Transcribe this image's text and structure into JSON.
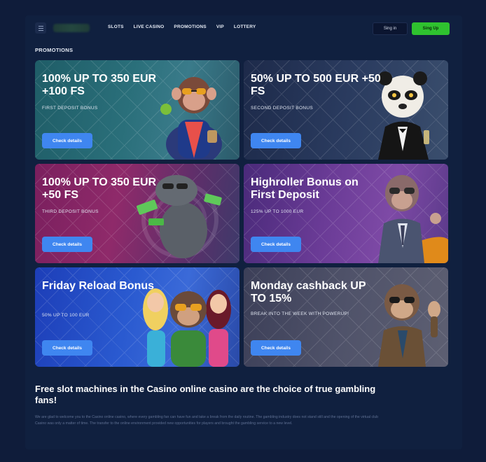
{
  "header": {
    "nav": [
      "SLOTS",
      "LIVE CASINO",
      "PROMOTIONS",
      "VIP",
      "LOTTERY"
    ],
    "signin_label": "Sing in",
    "signup_label": "Sing Up"
  },
  "section_title": "PROMOTIONS",
  "promos": [
    {
      "title": "100% UP TO 350 EUR +100 FS",
      "subtitle": "FIRST DEPOSIT BONUS",
      "cta": "Check details",
      "art": "monkey-sunglasses-cocktail"
    },
    {
      "title": "50% UP TO 500 EUR +50 FS",
      "subtitle": "SECOND DEPOSIT BONUS",
      "cta": "Check details",
      "art": "panda-tuxedo"
    },
    {
      "title": "100% UP TO 350 EUR +50 FS",
      "subtitle": "THIRD DEPOSIT BONUS",
      "cta": "Check details",
      "art": "hippo-cash"
    },
    {
      "title": "Highroller Bonus on First Deposit",
      "subtitle": "125% UP TO 1000 EUR",
      "cta": "Check details",
      "art": "monkey-suit-car"
    },
    {
      "title": "Friday Reload Bonus",
      "subtitle": "50% UP TO 100 EUR",
      "cta": "Check details",
      "art": "monkey-with-girls"
    },
    {
      "title": "Monday cashback UP TO 15%",
      "subtitle": "BREAK INTO THE WEEK WITH POWERUP!",
      "cta": "Check details",
      "art": "monkey-waving"
    }
  ],
  "article": {
    "title": "Free slot machines in the Casino online casino are the choice of true gambling fans!",
    "body": "We are glad to welcome you to the Casino online casino, where every gambling fan can have fun and take a break from the daily routine. The gambling industry does not stand still and the opening of the virtual club Casino was only a matter of time. The transfer to the online environment provided new opportunities for players and brought the gambling service to a new level."
  },
  "colors": {
    "background": "#0f1c3a",
    "accent_button": "#3f86f0",
    "signup_green": "#2fc22f"
  }
}
